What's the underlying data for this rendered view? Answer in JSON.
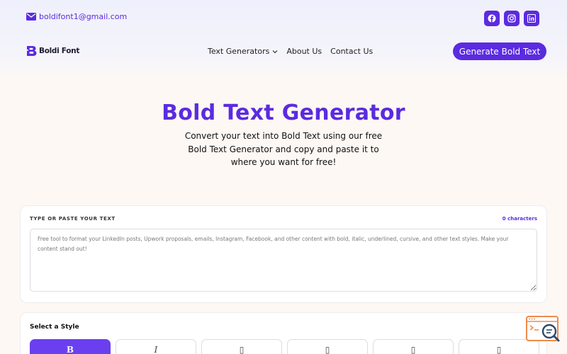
{
  "topbar": {
    "email": "boldifont1@gmail.com",
    "socials": [
      {
        "icon": "facebook-icon"
      },
      {
        "icon": "instagram-icon"
      },
      {
        "icon": "linkedin-icon"
      }
    ]
  },
  "nav": {
    "logo_text": "Boldi Font",
    "links": [
      "Text Generators",
      "About Us",
      "Contact Us"
    ],
    "cta": "Generate Bold Text"
  },
  "hero": {
    "title": "Bold Text Generator",
    "subtitle": "Convert your text into Bold Text using our free Bold Text Generator and copy and paste it to where you want for free!"
  },
  "input_card": {
    "label": "TYPE OR PASTE YOUR TEXT",
    "char_count": "0",
    "char_suffix": "characters",
    "placeholder": "Free tool to format your LinkedIn posts, Upwork proposals, emails, Instagram, Facebook, and other content with bold, italic, underlined, cursive, and other text styles. Make your content stand out!"
  },
  "style_card": {
    "title": "Select a Style",
    "styles": [
      "B",
      "I",
      "▯",
      "▯",
      "▯",
      "▯"
    ]
  },
  "colors": {
    "accent": "#5b2be0",
    "active_style": "#6a3ff0",
    "background": "#fdf8f4",
    "widget": "#f08a4b"
  }
}
